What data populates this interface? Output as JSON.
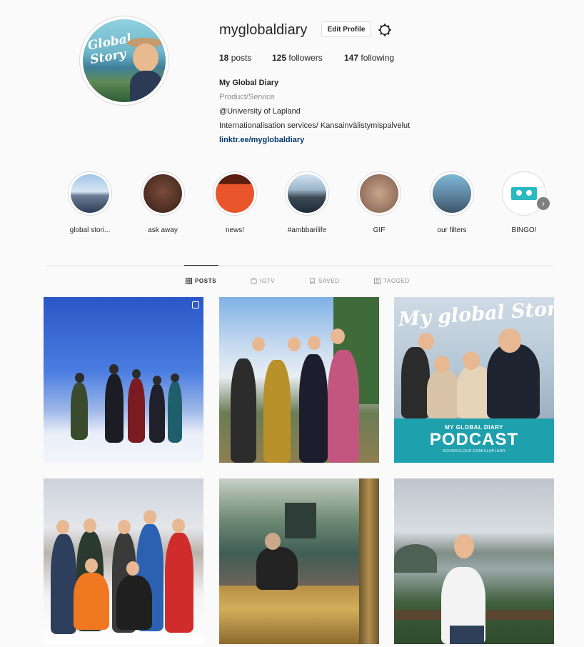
{
  "profile": {
    "username": "myglobaldiary",
    "edit_label": "Edit Profile",
    "avatar_text": "Global Story"
  },
  "stats": {
    "posts_count": "18",
    "posts_label": "posts",
    "followers_count": "125",
    "followers_label": "followers",
    "following_count": "147",
    "following_label": "following"
  },
  "bio": {
    "name": "My Global Diary",
    "category": "Product/Service",
    "line1": "@University of Lapland",
    "line2": "Internationalisation services/ Kansainvälistymispalvelut",
    "link": "linktr.ee/myglobaldiary"
  },
  "highlights": [
    {
      "label": "global stori..."
    },
    {
      "label": "ask away"
    },
    {
      "label": "news!"
    },
    {
      "label": "#ambbarilife"
    },
    {
      "label": "GIF"
    },
    {
      "label": "our filters"
    },
    {
      "label": "BINGO!"
    }
  ],
  "tabs": [
    {
      "label": "POSTS",
      "icon": "grid-icon"
    },
    {
      "label": "IGTV",
      "icon": "igtv-icon"
    },
    {
      "label": "SAVED",
      "icon": "bookmark-icon"
    },
    {
      "label": "TAGGED",
      "icon": "tag-icon"
    }
  ],
  "posts": {
    "podcast_script": "My global Story",
    "podcast_sub": "MY GLOBAL DIARY",
    "podcast_title": "PODCAST",
    "podcast_url": "SOUNDCLOUD.COM/ULAPLAND"
  },
  "colors": {
    "link": "#00376b",
    "muted": "#8e8e8e",
    "podcast_band": "#1fa1ad"
  }
}
